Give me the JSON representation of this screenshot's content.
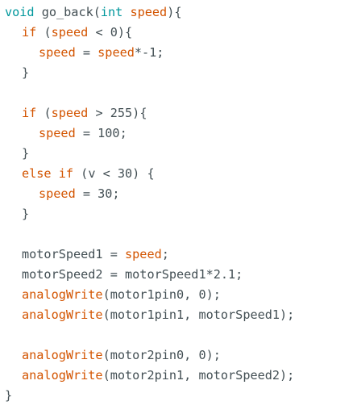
{
  "editor": {
    "colors": {
      "keyword": "#00979c",
      "variable": "#d35400",
      "default": "#434f54",
      "background": "#ffffff"
    },
    "lines": [
      {
        "indent": 0,
        "tokens": [
          {
            "text": "void",
            "kind": "keyword"
          },
          {
            "text": " go_back(",
            "kind": "default"
          },
          {
            "text": "int",
            "kind": "keyword"
          },
          {
            "text": " ",
            "kind": "default"
          },
          {
            "text": "speed",
            "kind": "variable"
          },
          {
            "text": "){",
            "kind": "default"
          }
        ]
      },
      {
        "indent": 1,
        "tokens": [
          {
            "text": "if",
            "kind": "variable"
          },
          {
            "text": " (",
            "kind": "default"
          },
          {
            "text": "speed",
            "kind": "variable"
          },
          {
            "text": " < 0){",
            "kind": "default"
          }
        ]
      },
      {
        "indent": 2,
        "tokens": [
          {
            "text": "speed",
            "kind": "variable"
          },
          {
            "text": " = ",
            "kind": "default"
          },
          {
            "text": "speed",
            "kind": "variable"
          },
          {
            "text": "*-1;",
            "kind": "default"
          }
        ]
      },
      {
        "indent": 1,
        "tokens": [
          {
            "text": "}",
            "kind": "default"
          }
        ]
      },
      {
        "indent": 0,
        "tokens": []
      },
      {
        "indent": 1,
        "tokens": [
          {
            "text": "if",
            "kind": "variable"
          },
          {
            "text": " (",
            "kind": "default"
          },
          {
            "text": "speed",
            "kind": "variable"
          },
          {
            "text": " > 255){",
            "kind": "default"
          }
        ]
      },
      {
        "indent": 2,
        "tokens": [
          {
            "text": "speed",
            "kind": "variable"
          },
          {
            "text": " = 100;",
            "kind": "default"
          }
        ]
      },
      {
        "indent": 1,
        "tokens": [
          {
            "text": "}",
            "kind": "default"
          }
        ]
      },
      {
        "indent": 1,
        "tokens": [
          {
            "text": "else",
            "kind": "variable"
          },
          {
            "text": " ",
            "kind": "default"
          },
          {
            "text": "if",
            "kind": "variable"
          },
          {
            "text": " (v < 30) {",
            "kind": "default"
          }
        ]
      },
      {
        "indent": 2,
        "tokens": [
          {
            "text": "speed",
            "kind": "variable"
          },
          {
            "text": " = 30;",
            "kind": "default"
          }
        ]
      },
      {
        "indent": 1,
        "tokens": [
          {
            "text": "}",
            "kind": "default"
          }
        ]
      },
      {
        "indent": 0,
        "tokens": []
      },
      {
        "indent": 1,
        "tokens": [
          {
            "text": "motorSpeed1 = ",
            "kind": "default"
          },
          {
            "text": "speed",
            "kind": "variable"
          },
          {
            "text": ";",
            "kind": "default"
          }
        ]
      },
      {
        "indent": 1,
        "tokens": [
          {
            "text": "motorSpeed2 = motorSpeed1*2.1;",
            "kind": "default"
          }
        ]
      },
      {
        "indent": 1,
        "tokens": [
          {
            "text": "analogWrite",
            "kind": "variable"
          },
          {
            "text": "(motor1pin0, 0);",
            "kind": "default"
          }
        ]
      },
      {
        "indent": 1,
        "tokens": [
          {
            "text": "analogWrite",
            "kind": "variable"
          },
          {
            "text": "(motor1pin1, motorSpeed1);",
            "kind": "default"
          }
        ]
      },
      {
        "indent": 0,
        "tokens": []
      },
      {
        "indent": 1,
        "tokens": [
          {
            "text": "analogWrite",
            "kind": "variable"
          },
          {
            "text": "(motor2pin0, 0);",
            "kind": "default"
          }
        ]
      },
      {
        "indent": 1,
        "tokens": [
          {
            "text": "analogWrite",
            "kind": "variable"
          },
          {
            "text": "(motor2pin1, motorSpeed2);",
            "kind": "default"
          }
        ]
      },
      {
        "indent": 0,
        "tokens": [
          {
            "text": "}",
            "kind": "default"
          }
        ]
      }
    ]
  }
}
